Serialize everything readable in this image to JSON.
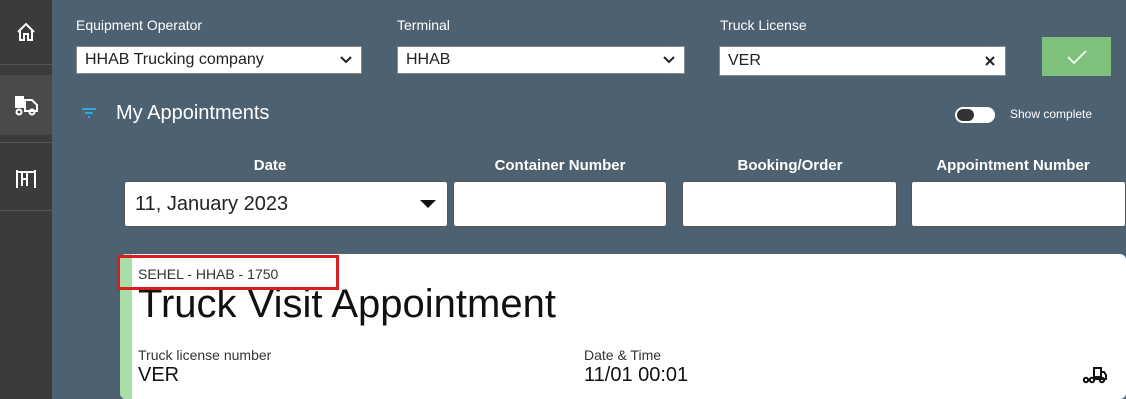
{
  "sidebar": {
    "items": [
      {
        "icon": "home-icon"
      },
      {
        "icon": "truck-icon"
      },
      {
        "icon": "gate-icon"
      }
    ]
  },
  "filters": {
    "operator_label": "Equipment Operator",
    "operator_value": "HHAB Trucking company",
    "terminal_label": "Terminal",
    "terminal_value": "HHAB",
    "license_label": "Truck License",
    "license_value": "VER",
    "accent_color": "#7dc17d"
  },
  "section": {
    "title": "My Appointments",
    "show_complete_label": "Show complete"
  },
  "columns": {
    "date": "Date",
    "container": "Container Number",
    "booking": "Booking/Order",
    "appointment": "Appointment Number",
    "date_value": "11, January 2023"
  },
  "card": {
    "reference": "SEHEL - HHAB - 1750",
    "title": "Truck Visit Appointment",
    "license_label": "Truck license number",
    "license_value": "VER",
    "datetime_label": "Date & Time",
    "datetime_value": "11/01 00:01"
  }
}
